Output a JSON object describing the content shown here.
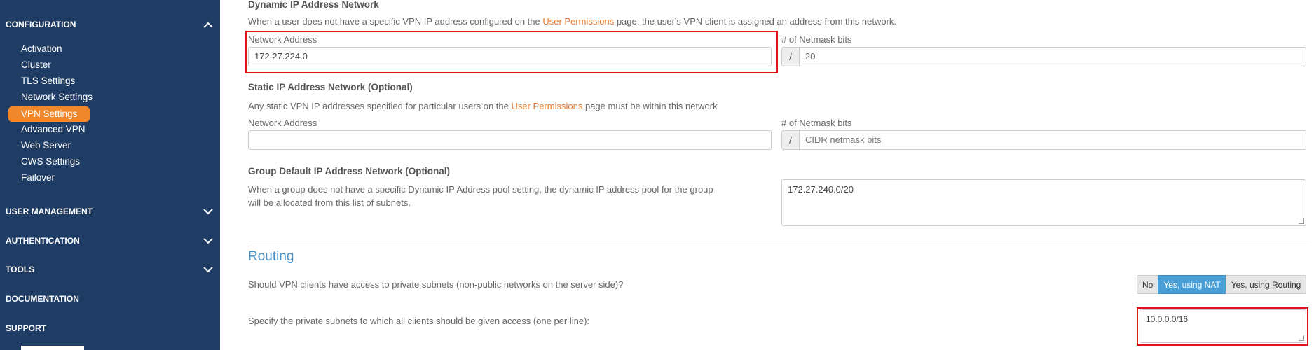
{
  "sidebar": {
    "configuration": "CONFIGURATION",
    "config_items": [
      "Activation",
      "Cluster",
      "TLS Settings",
      "Network Settings",
      "VPN Settings",
      "Advanced VPN",
      "Web Server",
      "CWS Settings",
      "Failover"
    ],
    "active_item": "VPN Settings",
    "user_management": "USER MANAGEMENT",
    "authentication": "AUTHENTICATION",
    "tools": "TOOLS",
    "documentation": "DOCUMENTATION",
    "support": "SUPPORT"
  },
  "dynamic": {
    "heading": "Dynamic IP Address Network",
    "desc_before": "When a user does not have a specific VPN IP address configured on the ",
    "desc_link": "User Permissions",
    "desc_after": " page, the user's VPN client is assigned an address from this network.",
    "network_label": "Network Address",
    "network_value": "172.27.224.0",
    "netmask_label": "# of Netmask bits",
    "netmask_prefix": "/",
    "netmask_value": "20"
  },
  "static": {
    "heading": "Static IP Address Network (Optional)",
    "desc_before": "Any static VPN IP addresses specified for particular users on the ",
    "desc_link": "User Permissions",
    "desc_after": " page must be within this network",
    "network_label": "Network Address",
    "network_value": "",
    "netmask_label": "# of Netmask bits",
    "netmask_prefix": "/",
    "netmask_placeholder": "CIDR netmask bits"
  },
  "group": {
    "heading": "Group Default IP Address Network (Optional)",
    "desc_line1": "When a group does not have a specific Dynamic IP Address pool setting, the dynamic IP address pool for the group",
    "desc_line2": "will be allocated from this list of subnets.",
    "value": "172.27.240.0/20"
  },
  "routing": {
    "title": "Routing",
    "question": "Should VPN clients have access to private subnets (non-public networks on the server side)?",
    "options": [
      "No",
      "Yes, using NAT",
      "Yes, using Routing"
    ],
    "selected": "Yes, using NAT",
    "subnets_label": "Specify the private subnets to which all clients should be given access (one per line):",
    "subnets_value": "10.0.0.0/16"
  },
  "colors": {
    "sidebar_bg": "#1f3c64",
    "accent": "#f0882b",
    "link": "#e8792b",
    "highlight": "#e0141b",
    "selected_button": "#4a9ed6"
  },
  "icons": {
    "expanded": "chevron-up-icon",
    "collapsed": "chevron-down-icon"
  }
}
